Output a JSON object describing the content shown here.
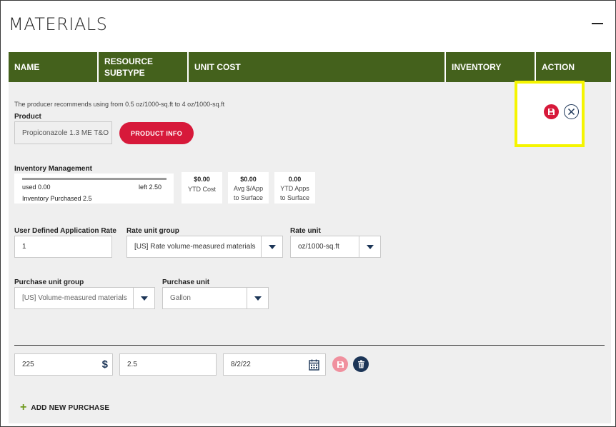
{
  "section": {
    "title": "MATERIALS"
  },
  "table_headers": [
    "NAME",
    "RESOURCE\nSUBTYPE",
    "UNIT COST",
    "INVENTORY",
    "ACTION"
  ],
  "hint": "The producer recommends using from 0.5 oz/1000-sq.ft to 4 oz/1000-sq.ft",
  "product": {
    "label": "Product",
    "value": "Propiconazole 1.3 ME T&O",
    "info_button": "PRODUCT INFO"
  },
  "inventory": {
    "label": "Inventory Management",
    "used": "used 0.00",
    "left": "left 2.50",
    "purchased": "Inventory Purchased 2.5",
    "stats": [
      {
        "value": "$0.00",
        "label": "YTD Cost"
      },
      {
        "value": "$0.00",
        "label": "Avg $/App\nto Surface"
      },
      {
        "value": "0.00",
        "label": "YTD Apps\nto Surface"
      }
    ]
  },
  "rate": {
    "user_rate_label": "User Defined Application Rate",
    "user_rate_value": "1",
    "unit_group_label": "Rate unit group",
    "unit_group_value": "[US] Rate volume-measured materials",
    "unit_label": "Rate unit",
    "unit_value": "oz/1000-sq.ft"
  },
  "purchase": {
    "unit_group_label": "Purchase unit group",
    "unit_group_value": "[US] Volume-measured materials",
    "unit_label": "Purchase unit",
    "unit_value": "Gallon"
  },
  "purchase_row": {
    "cost": "225",
    "currency_symbol": "$",
    "quantity": "2.5",
    "date": "8/2/22"
  },
  "add_purchase": {
    "label": "ADD NEW PURCHASE"
  },
  "colors": {
    "header_green": "#44611c",
    "brand_red": "#d7193a",
    "navy": "#1c3557",
    "highlight": "#f5f500"
  }
}
